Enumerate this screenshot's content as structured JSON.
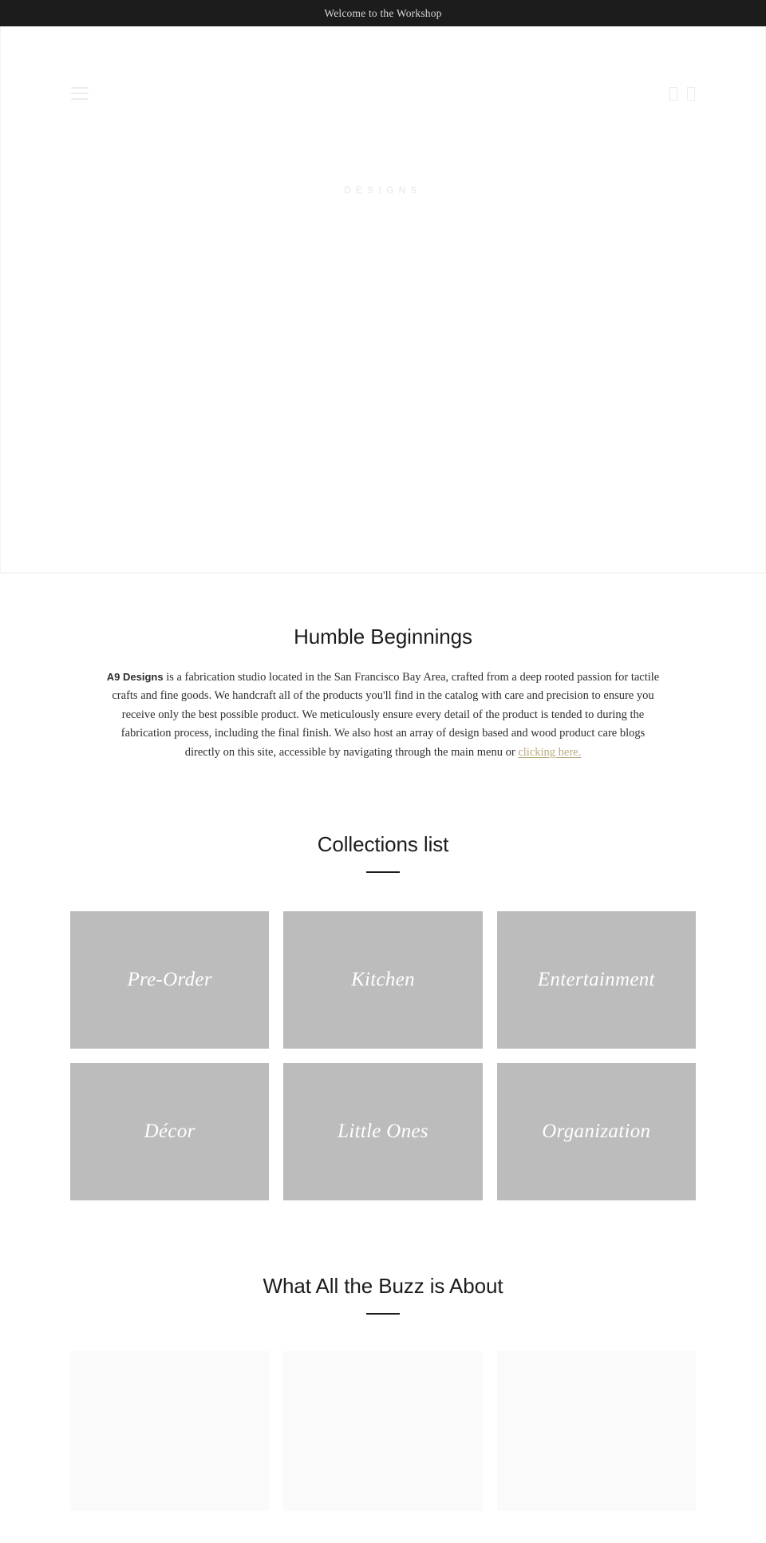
{
  "announcement": {
    "text": "Welcome to the Workshop"
  },
  "header": {
    "menu_icon": "hamburger-menu-icon",
    "search_icon": "search-icon",
    "cart_icon": "cart-icon",
    "logo_text": "DESIGNS"
  },
  "about": {
    "title": "Humble Beginnings",
    "lead": "A9 Designs",
    "body": " is a fabrication studio located in the San Francisco Bay Area, crafted from a deep rooted passion for tactile crafts and fine goods. We handcraft all of the products you'll find in the catalog with care and precision to ensure you receive only the best possible product. We meticulously ensure every detail of the product is tended to during the fabrication process, including the final finish. We also host an array of design based and wood product care blogs directly on this site, accessible by navigating through the main menu or ",
    "link_text": "clicking here.",
    "link_color": "#b6a87e"
  },
  "collections": {
    "title": "Collections list",
    "tile_color": "#bcbcbc",
    "items": [
      {
        "label": "Pre-Order"
      },
      {
        "label": "Kitchen"
      },
      {
        "label": "Entertainment"
      },
      {
        "label": "Décor"
      },
      {
        "label": "Little Ones"
      },
      {
        "label": "Organization"
      }
    ]
  },
  "buzz": {
    "title": "What All the Buzz is About",
    "card_color": "#fafafa",
    "cards": [
      {
        "label": ""
      },
      {
        "label": ""
      },
      {
        "label": ""
      }
    ]
  }
}
